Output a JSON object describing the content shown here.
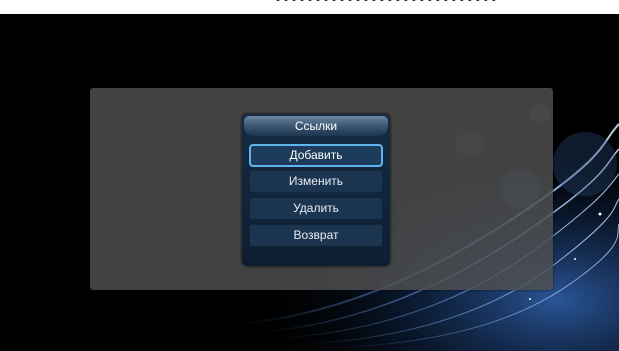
{
  "dialog": {
    "title": "Ссылки",
    "items": [
      {
        "label": "Добавить",
        "selected": true
      },
      {
        "label": "Изменить",
        "selected": false
      },
      {
        "label": "Удалить",
        "selected": false
      },
      {
        "label": "Возврат",
        "selected": false
      }
    ]
  },
  "colors": {
    "selection_border": "#5fb6ee",
    "item_background": "#1b3450",
    "panel_background": "#505050"
  }
}
